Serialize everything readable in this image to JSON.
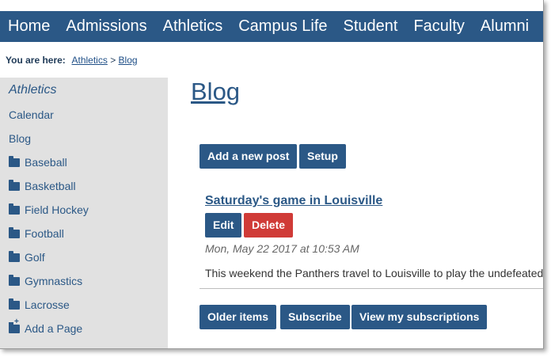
{
  "nav": [
    "Home",
    "Admissions",
    "Athletics",
    "Campus Life",
    "Student",
    "Faculty",
    "Alumni"
  ],
  "breadcrumb": {
    "label": "You are here:",
    "section": "Athletics",
    "separator": ">",
    "current": "Blog"
  },
  "sidebar": {
    "title": "Athletics",
    "links": [
      "Calendar",
      "Blog"
    ],
    "folders": [
      "Baseball",
      "Basketball",
      "Field Hockey",
      "Football",
      "Golf",
      "Gymnastics",
      "Lacrosse"
    ],
    "add_page": "Add a Page"
  },
  "main": {
    "title": "Blog",
    "add_post_label": "Add a new post",
    "setup_label": "Setup",
    "post": {
      "title": "Saturday's game in Louisville",
      "edit_label": "Edit",
      "delete_label": "Delete",
      "date": "Mon, May 22 2017 at 10:53 AM",
      "excerpt": "This weekend the Panthers travel to Louisville to play the undefeated"
    },
    "older_label": "Older items",
    "subscribe_label": "Subscribe",
    "subscriptions_label": "View my subscriptions"
  },
  "colors": {
    "primary": "#2b5886",
    "danger": "#d03b37",
    "sidebar_bg": "#e1e1e1"
  }
}
